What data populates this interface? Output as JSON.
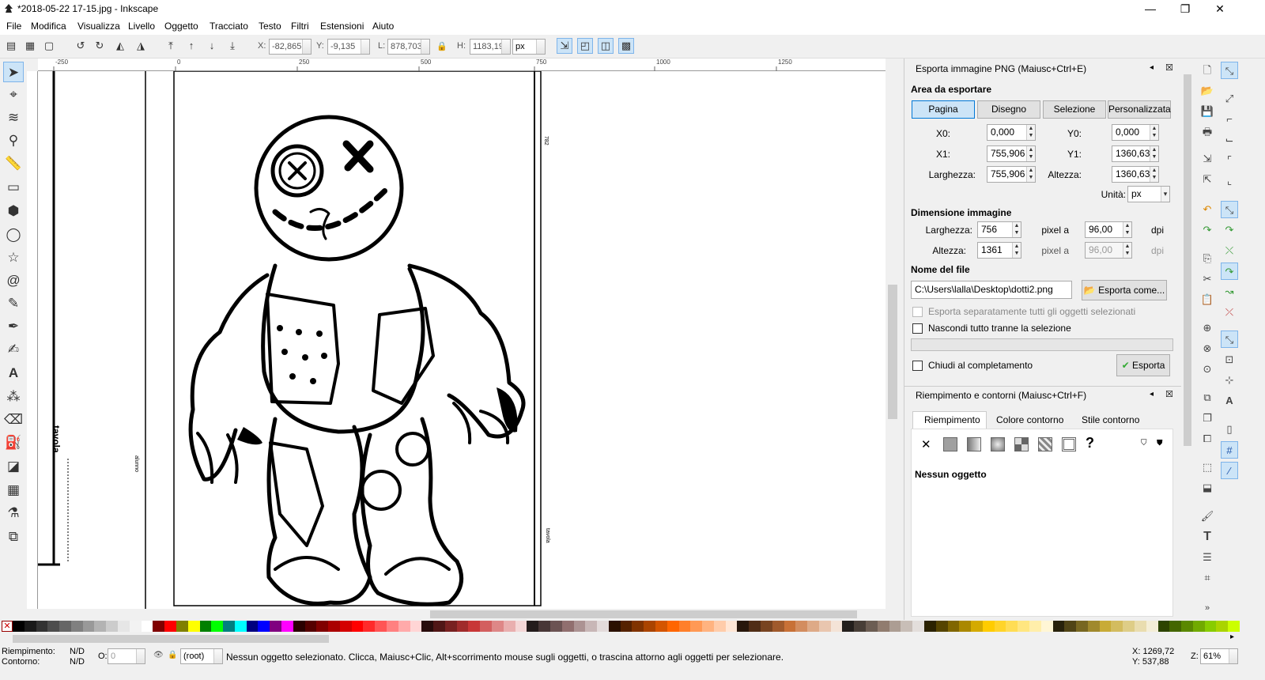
{
  "window": {
    "title": "*2018-05-22 17-15.jpg - Inkscape",
    "minimize": "—",
    "maximize": "❐",
    "close": "✕"
  },
  "menu": [
    "File",
    "Modifica",
    "Visualizza",
    "Livello",
    "Oggetto",
    "Tracciato",
    "Testo",
    "Filtri",
    "Estensioni",
    "Aiuto"
  ],
  "controls": {
    "x_label": "X:",
    "x_value": "-82,865",
    "y_label": "Y:",
    "y_value": "-9,135",
    "w_label": "L:",
    "w_value": "878,703",
    "h_label": "H:",
    "h_value": "1183,19",
    "unit": "px"
  },
  "ruler": {
    "labels": [
      "-250",
      "0",
      "250",
      "500",
      "750",
      "1000",
      "1250"
    ]
  },
  "canvas": {
    "text_tavola": "tavola",
    "text_alunno": "alunno",
    "text_tavola2": "tavola",
    "text_side": "782"
  },
  "export_panel": {
    "title": "Esporta immagine PNG (Maiusc+Ctrl+E)",
    "area_title": "Area da esportare",
    "area_buttons": [
      "Pagina",
      "Disegno",
      "Selezione",
      "Personalizzata"
    ],
    "x0_label": "X0:",
    "x0": "0,000",
    "y0_label": "Y0:",
    "y0": "0,000",
    "x1_label": "X1:",
    "x1": "755,906",
    "y1_label": "Y1:",
    "y1": "1360,630",
    "width_label": "Larghezza:",
    "width": "755,906",
    "height_label": "Altezza:",
    "height": "1360,630",
    "unit_label": "Unità:",
    "unit": "px",
    "dim_title": "Dimensione immagine",
    "img_w_label": "Larghezza:",
    "img_w": "756",
    "img_h_label": "Altezza:",
    "img_h": "1361",
    "pixel_at": "pixel a",
    "dpi_w": "96,00",
    "dpi_h": "96,00",
    "dpi": "dpi",
    "file_title": "Nome del file",
    "filename": "C:\\Users\\lalla\\Desktop\\dotti2.png",
    "export_as": "Esporta come...",
    "chk_separate": "Esporta separatamente tutti gli oggetti selezionati",
    "chk_hide": "Nascondi tutto tranne la selezione",
    "chk_close": "Chiudi al completamento",
    "export_btn": "Esporta"
  },
  "fill_panel": {
    "title": "Riempimento e contorni (Maiusc+Ctrl+F)",
    "tabs": [
      "Riempimento",
      "Colore contorno",
      "Stile contorno"
    ],
    "no_object": "Nessun oggetto"
  },
  "status": {
    "fill_label": "Riempimento:",
    "fill_value": "N/D",
    "stroke_label": "Contorno:",
    "stroke_value": "N/D",
    "opacity_label": "O:",
    "opacity": "0",
    "layer": "(root)",
    "message": "Nessun oggetto selezionato. Clicca, Maiusc+Clic, Alt+scorrimento mouse sugli oggetti, o trascina attorno agli oggetti per selezionare.",
    "x_coord": "X: 1269,72",
    "y_coord": "Y:  537,88",
    "zoom_label": "Z:",
    "zoom": "61%"
  },
  "palette_colors": [
    "#000000",
    "#1a1a1a",
    "#333333",
    "#4d4d4d",
    "#666666",
    "#808080",
    "#999999",
    "#b3b3b3",
    "#cccccc",
    "#e6e6e6",
    "#f2f2f2",
    "#ffffff",
    "#800000",
    "#ff0000",
    "#808000",
    "#ffff00",
    "#008000",
    "#00ff00",
    "#008080",
    "#00ffff",
    "#000080",
    "#0000ff",
    "#800080",
    "#ff00ff",
    "#2b0000",
    "#550000",
    "#800000",
    "#aa0000",
    "#d40000",
    "#ff0000",
    "#ff2a2a",
    "#ff5555",
    "#ff8080",
    "#ffaaaa",
    "#ffd5d5",
    "#280b0b",
    "#501616",
    "#782121",
    "#a02c2c",
    "#c83737",
    "#d35f5f",
    "#de8787",
    "#e9afaf",
    "#f4d7d7",
    "#241c1c",
    "#483737",
    "#6c5353",
    "#916f6f",
    "#ac9393",
    "#c8b7b7",
    "#e3dbdb",
    "#2b1100",
    "#552200",
    "#803300",
    "#aa4400",
    "#d45500",
    "#ff6600",
    "#ff7f2a",
    "#ff9955",
    "#ffb380",
    "#ffccaa",
    "#ffe6d5",
    "#28170b",
    "#502d16",
    "#784421",
    "#a05a2c",
    "#c87137",
    "#d38d5f",
    "#deaa87",
    "#e9c6af",
    "#f4e3d7",
    "#241f1c",
    "#483e37",
    "#6c5d53",
    "#917c6f",
    "#ac9d93",
    "#c8beb7",
    "#e3dedb",
    "#2b2200",
    "#554400",
    "#806600",
    "#aa8800",
    "#d4aa00",
    "#ffcc00",
    "#ffd42a",
    "#ffdd55",
    "#ffe680",
    "#ffeeaa",
    "#fff6d5",
    "#28220b",
    "#504416",
    "#786721",
    "#a0892c",
    "#c8ab37",
    "#d3bc5f",
    "#decd87",
    "#e9ddaf",
    "#f4eed7",
    "#2d4400",
    "#446600",
    "#5a8800",
    "#71aa00",
    "#88cc00",
    "#aad400",
    "#ccff00"
  ]
}
